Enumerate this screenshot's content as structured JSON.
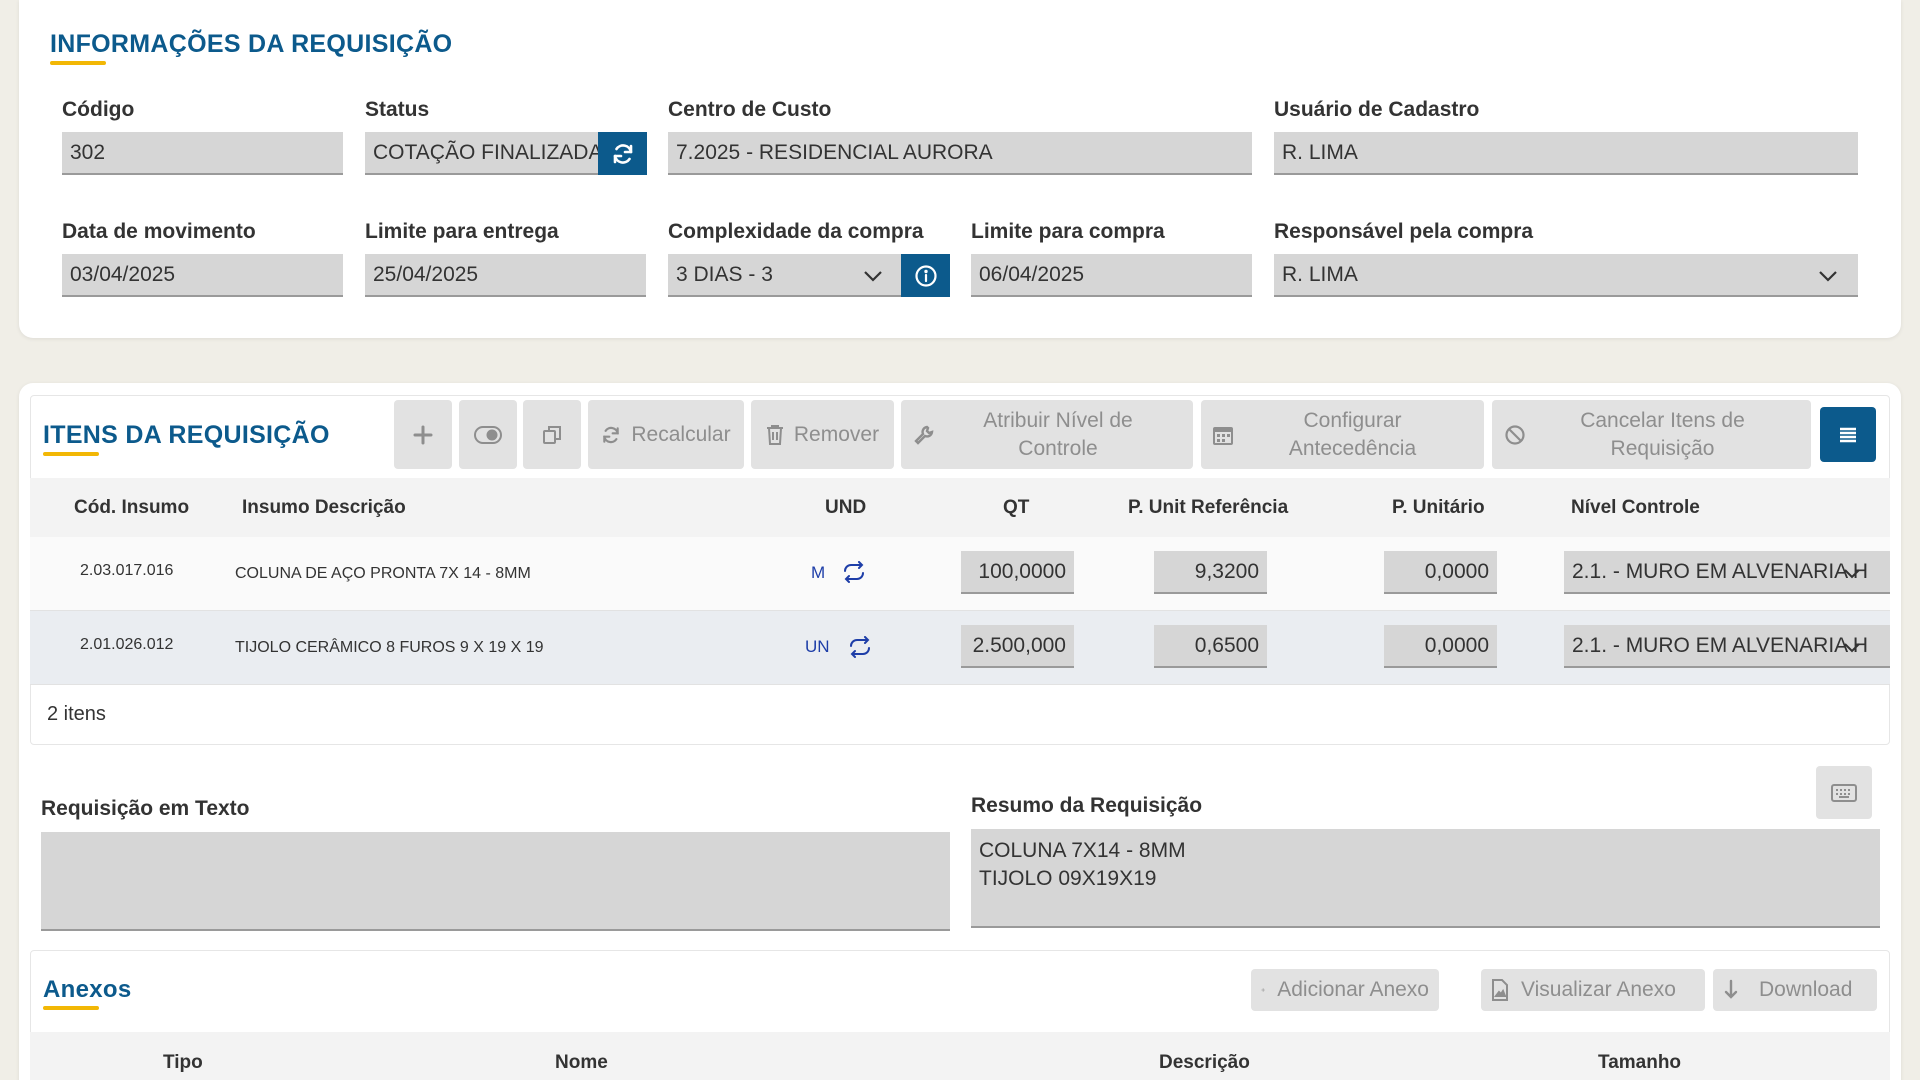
{
  "info": {
    "title": "INFORMAÇÕES DA REQUISIÇÃO",
    "codigo": {
      "label": "Código",
      "value": "302"
    },
    "status": {
      "label": "Status",
      "value": "COTAÇÃO FINALIZADA"
    },
    "centro_custo": {
      "label": "Centro de Custo",
      "value": "7.2025 - RESIDENCIAL AURORA"
    },
    "usuario_cadastro": {
      "label": "Usuário de Cadastro",
      "value": "R. LIMA"
    },
    "data_movimento": {
      "label": "Data de movimento",
      "value": "03/04/2025"
    },
    "limite_entrega": {
      "label": "Limite para entrega",
      "value": "25/04/2025"
    },
    "complexidade": {
      "label": "Complexidade da compra",
      "value": "3 DIAS - 3"
    },
    "limite_compra": {
      "label": "Limite para compra",
      "value": "06/04/2025"
    },
    "responsavel": {
      "label": "Responsável pela compra",
      "value": "R. LIMA"
    }
  },
  "itens": {
    "title": "ITENS DA REQUISIÇÃO",
    "toolbar": {
      "recalcular": "Recalcular",
      "remover": "Remover",
      "atribuir": "Atribuir Nível de Controle",
      "configurar": "Configurar Antecedência",
      "cancelar": "Cancelar Itens de Requisição"
    },
    "columns": {
      "cod": "Cód. Insumo",
      "desc": "Insumo Descrição",
      "und": "UND",
      "qt": "QT",
      "punit_ref": "P. Unit Referência",
      "punit": "P. Unitário",
      "nivel": "Nível Controle"
    },
    "rows": [
      {
        "cod": "2.03.017.016",
        "desc": "COLUNA DE AÇO PRONTA 7X 14 - 8MM",
        "und": "M",
        "qt": "100,0000",
        "punit_ref": "9,3200",
        "punit": "0,0000",
        "nivel": "2.1. - MURO EM ALVENARIA H"
      },
      {
        "cod": "2.01.026.012",
        "desc": "TIJOLO CERÂMICO 8 FUROS 9 X 19 X 19",
        "und": "UN",
        "qt": "2.500,000",
        "punit_ref": "0,6500",
        "punit": "0,0000",
        "nivel": "2.1. - MURO EM ALVENARIA H"
      }
    ],
    "count": "2 itens"
  },
  "texto": {
    "label": "Requisição em Texto",
    "value": ""
  },
  "resumo": {
    "label": "Resumo da Requisição",
    "line1": "COLUNA 7X14 - 8MM",
    "line2": "TIJOLO 09X19X19"
  },
  "anexos": {
    "title": "Anexos",
    "adicionar": "Adicionar Anexo",
    "visualizar": "Visualizar Anexo",
    "download": "Download",
    "columns": {
      "tipo": "Tipo",
      "nome": "Nome",
      "descricao": "Descrição",
      "tamanho": "Tamanho"
    }
  },
  "colors": {
    "accent": "#0c5a8c",
    "underline": "#f2b705",
    "field": "#d6d6d6"
  }
}
